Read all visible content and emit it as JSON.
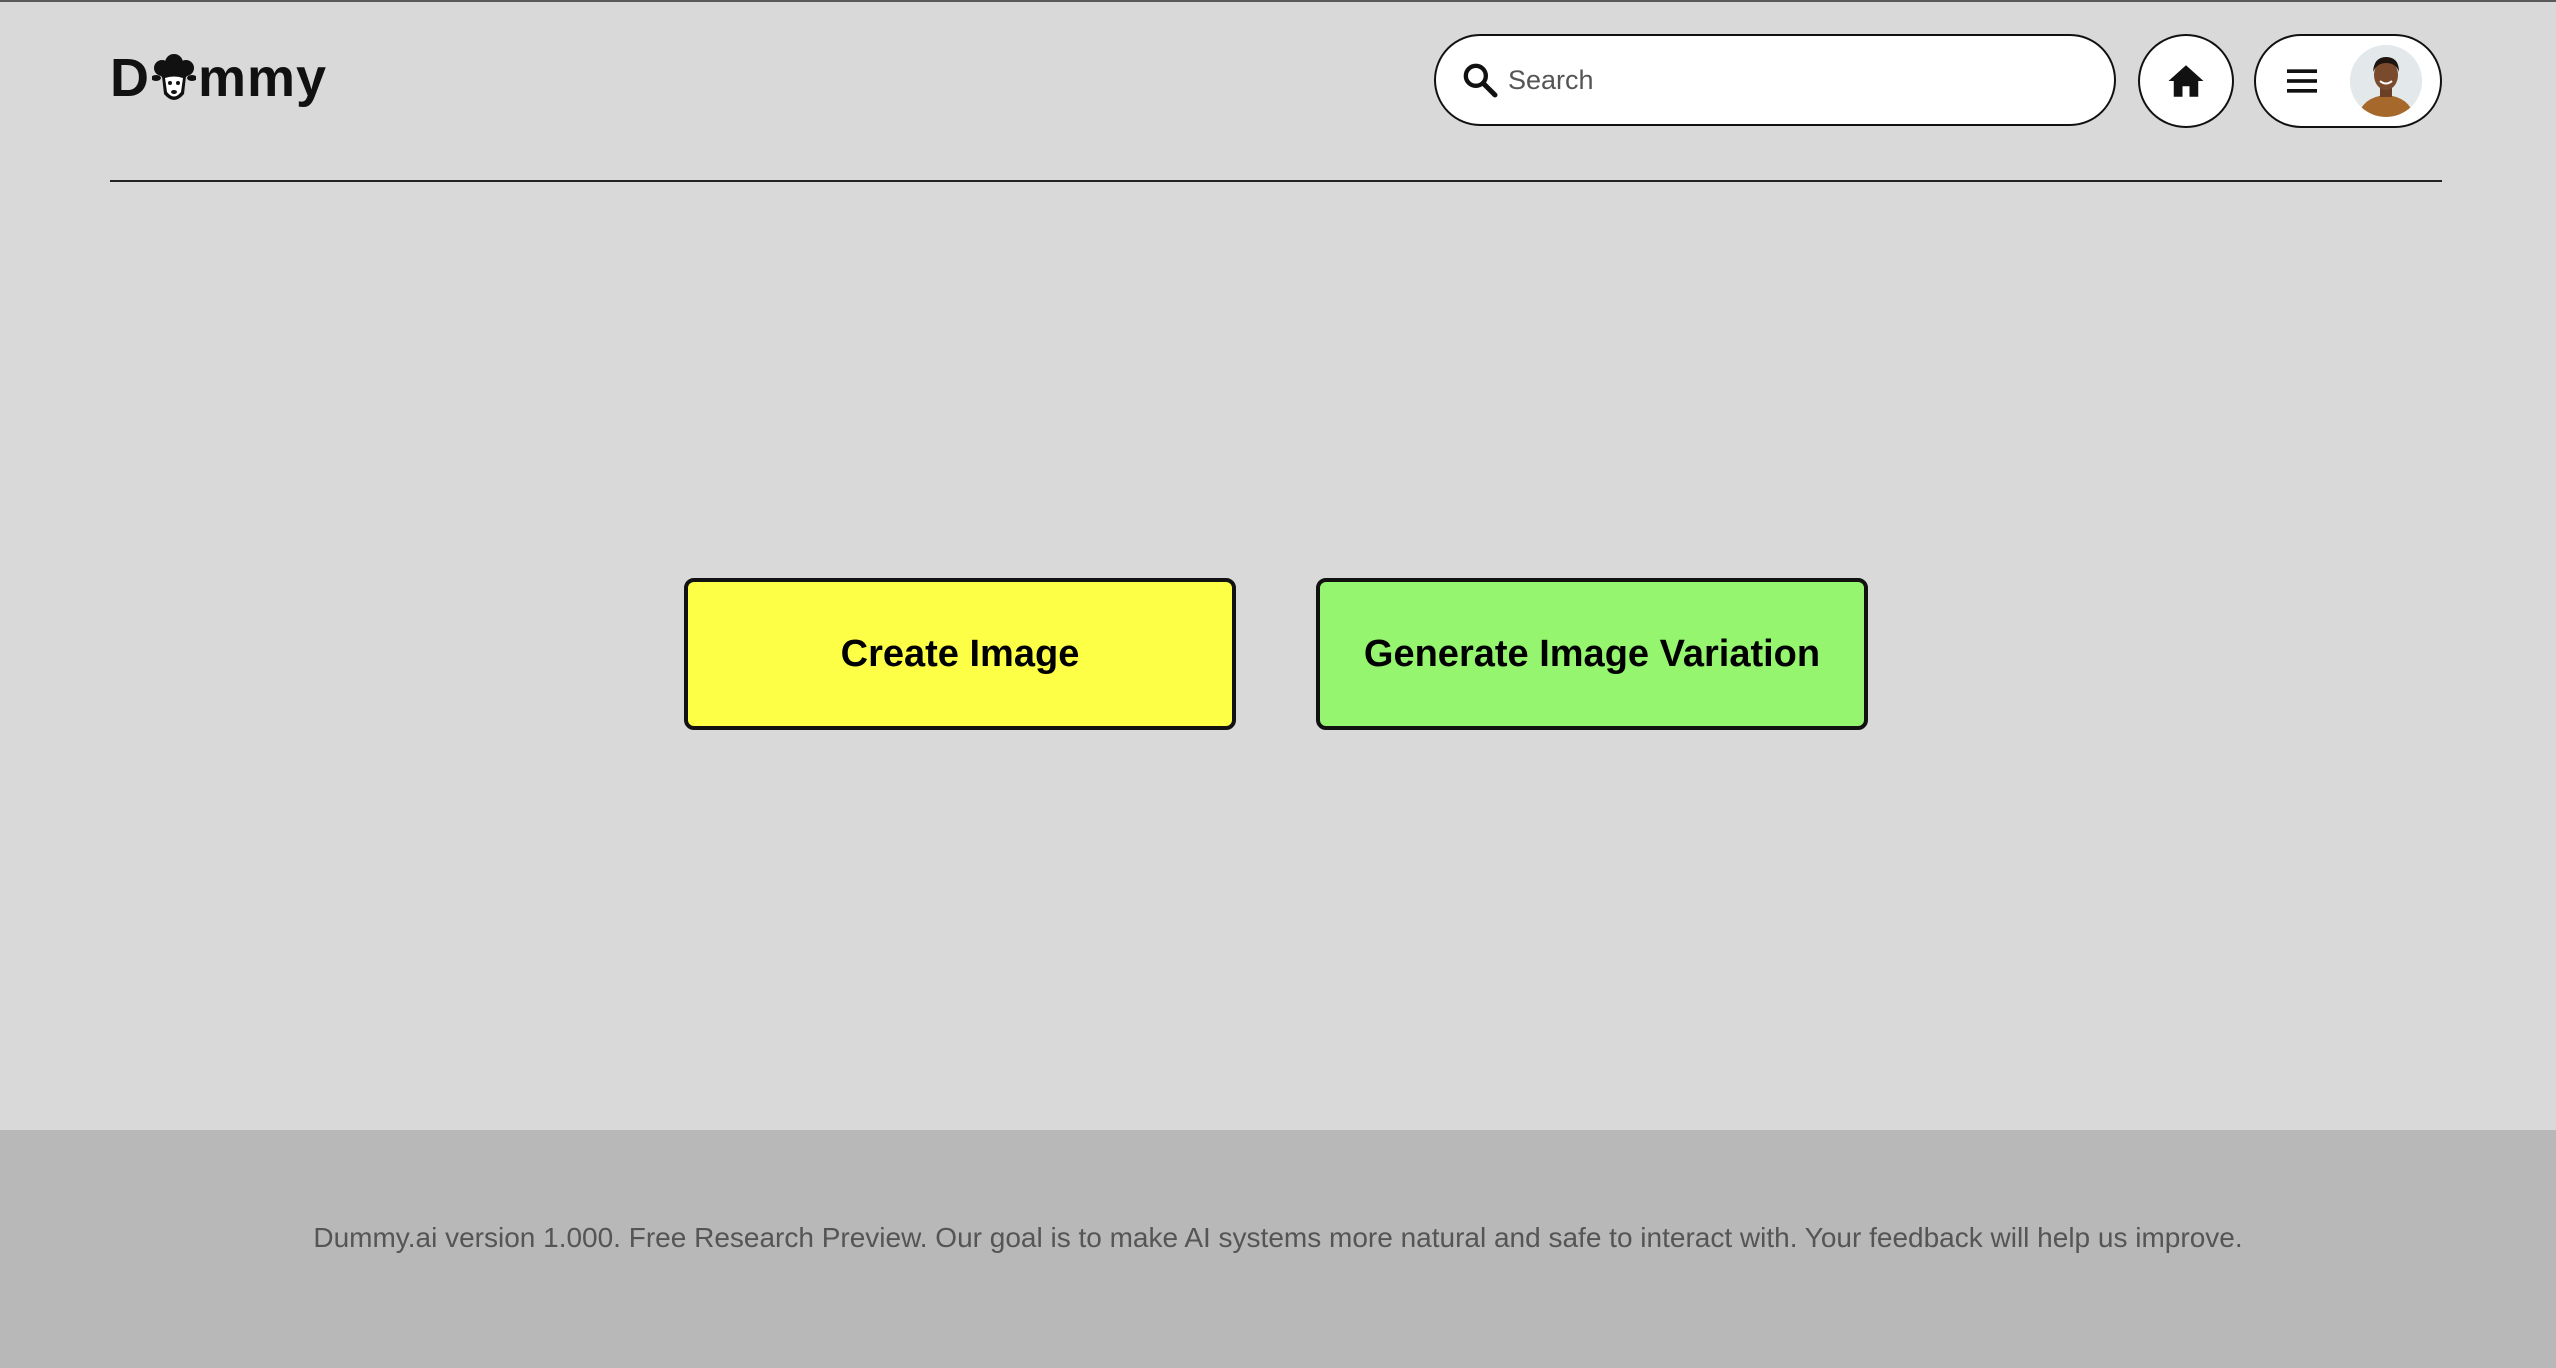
{
  "app": {
    "logo": {
      "first_letter": "D",
      "rest": "mmy",
      "mascot_icon": "sheep-head-icon"
    }
  },
  "header": {
    "search": {
      "placeholder": "Search",
      "value": "",
      "icon": "search-icon"
    },
    "home_button": {
      "icon": "home-icon"
    },
    "menu_button": {
      "icon": "hamburger-menu-icon",
      "avatar": "user-avatar"
    }
  },
  "main": {
    "create_image_label": "Create Image",
    "generate_variation_label": "Generate Image Variation"
  },
  "footer": {
    "text": "Dummy.ai version 1.000. Free Research Preview. Our goal is to make AI systems more natural and safe to interact with. Your feedback will help us improve."
  },
  "colors": {
    "page_background": "#d9d9d9",
    "footer_background": "#b8b8b8",
    "create_button": "#fdff47",
    "variation_button": "#95f56f",
    "border": "#111111"
  }
}
